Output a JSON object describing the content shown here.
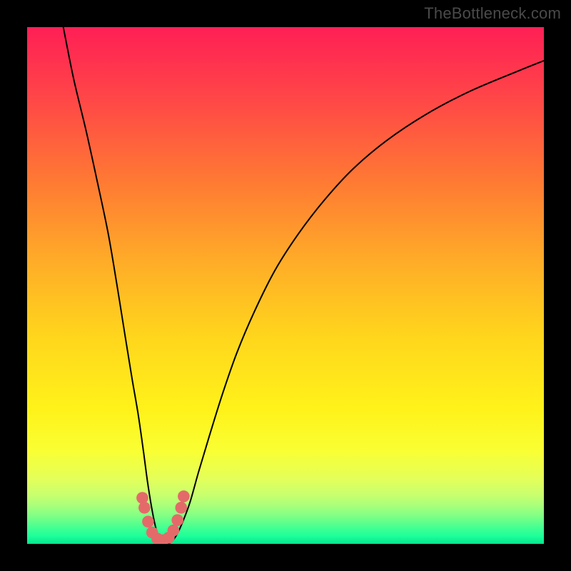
{
  "watermark": "TheBottleneck.com",
  "chart_data": {
    "type": "line",
    "title": "",
    "xlabel": "",
    "ylabel": "",
    "xlim": [
      0,
      100
    ],
    "ylim": [
      0,
      100
    ],
    "grid": false,
    "legend": false,
    "note": "Abstract bottleneck curve; no axis ticks or numeric labels are shown. x/y are in percent of plot area (0–100). Curve is a V shape with minimum near x≈26, y≈0. Background is a vertical red→yellow→green gradient.",
    "gradient_stops": [
      {
        "offset": 0.0,
        "color": "#ff1f55"
      },
      {
        "offset": 0.14,
        "color": "#ff4747"
      },
      {
        "offset": 0.3,
        "color": "#ff7a33"
      },
      {
        "offset": 0.45,
        "color": "#ffab28"
      },
      {
        "offset": 0.6,
        "color": "#ffd61c"
      },
      {
        "offset": 0.74,
        "color": "#fff21a"
      },
      {
        "offset": 0.82,
        "color": "#f9ff33"
      },
      {
        "offset": 0.875,
        "color": "#e3ff5a"
      },
      {
        "offset": 0.905,
        "color": "#c9ff6e"
      },
      {
        "offset": 0.925,
        "color": "#aaff7a"
      },
      {
        "offset": 0.945,
        "color": "#82ff85"
      },
      {
        "offset": 0.965,
        "color": "#4dff90"
      },
      {
        "offset": 0.985,
        "color": "#1cff9a"
      },
      {
        "offset": 1.0,
        "color": "#05e58e"
      }
    ],
    "series": [
      {
        "name": "bottleneck-curve",
        "x": [
          7.0,
          9.0,
          11.4,
          13.6,
          15.7,
          17.4,
          19.0,
          20.3,
          21.5,
          22.5,
          23.3,
          24.1,
          24.8,
          25.5,
          26.5,
          27.7,
          28.8,
          30.0,
          31.5,
          33.2,
          35.3,
          37.8,
          40.6,
          44.0,
          48.0,
          52.5,
          57.5,
          63.0,
          69.5,
          77.0,
          85.5,
          95.0,
          100.0
        ],
        "y": [
          100.0,
          90.0,
          80.0,
          70.0,
          60.0,
          50.0,
          40.0,
          32.0,
          25.0,
          18.0,
          12.0,
          7.0,
          3.5,
          1.2,
          0.0,
          0.2,
          1.5,
          4.0,
          8.0,
          14.0,
          21.0,
          29.0,
          37.0,
          45.0,
          53.0,
          60.0,
          66.5,
          72.5,
          78.0,
          83.0,
          87.5,
          91.5,
          93.5
        ]
      }
    ],
    "markers": [
      {
        "x": 22.3,
        "y": 8.9,
        "r": 1.15,
        "color": "#e46a6a"
      },
      {
        "x": 22.7,
        "y": 7.0,
        "r": 1.15,
        "color": "#e46a6a"
      },
      {
        "x": 23.4,
        "y": 4.3,
        "r": 1.15,
        "color": "#e46a6a"
      },
      {
        "x": 24.2,
        "y": 2.2,
        "r": 1.15,
        "color": "#e46a6a"
      },
      {
        "x": 25.2,
        "y": 1.0,
        "r": 1.15,
        "color": "#e46a6a"
      },
      {
        "x": 26.3,
        "y": 0.7,
        "r": 1.15,
        "color": "#e46a6a"
      },
      {
        "x": 27.4,
        "y": 1.2,
        "r": 1.15,
        "color": "#e46a6a"
      },
      {
        "x": 28.3,
        "y": 2.6,
        "r": 1.15,
        "color": "#e46a6a"
      },
      {
        "x": 29.1,
        "y": 4.6,
        "r": 1.15,
        "color": "#e46a6a"
      },
      {
        "x": 29.8,
        "y": 7.0,
        "r": 1.15,
        "color": "#e46a6a"
      },
      {
        "x": 30.3,
        "y": 9.2,
        "r": 1.15,
        "color": "#e46a6a"
      }
    ]
  }
}
